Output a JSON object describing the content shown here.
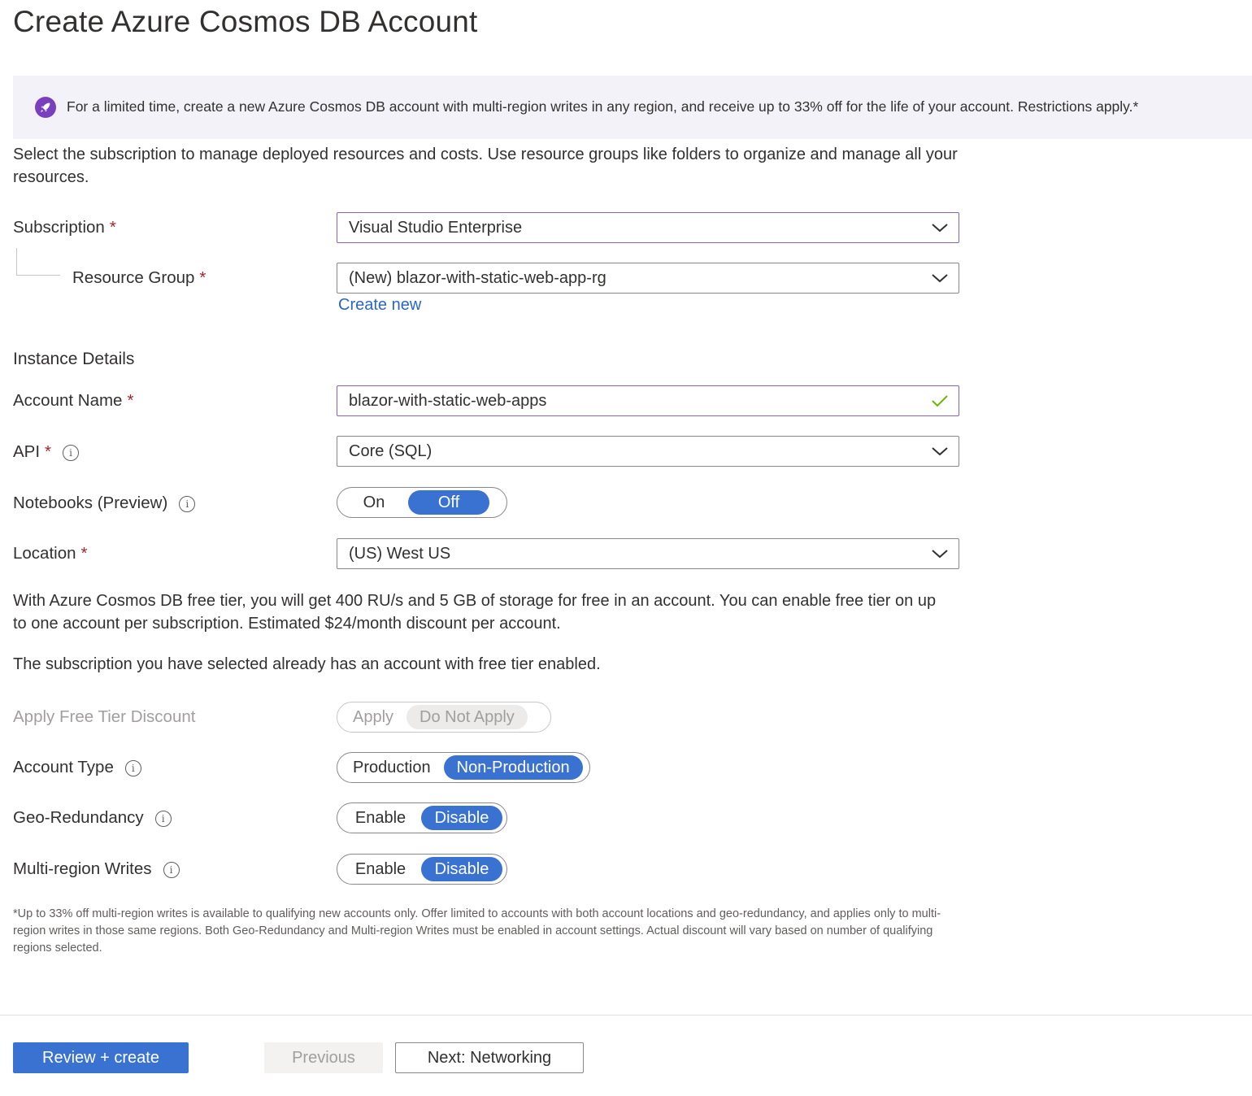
{
  "page": {
    "title": "Create Azure Cosmos DB Account"
  },
  "banner": {
    "icon": "rocket-icon",
    "text": "For a limited time, create a new Azure Cosmos DB account with multi-region writes in any region, and receive up to 33% off for the life of your account. Restrictions apply.*"
  },
  "intro": "Select the subscription to manage deployed resources and costs. Use resource groups like folders to organize and manage all your resources.",
  "required_marker": "*",
  "subscription": {
    "label": "Subscription",
    "value": "Visual Studio Enterprise"
  },
  "resource_group": {
    "label": "Resource Group",
    "value": "(New) blazor-with-static-web-app-rg",
    "create_new": "Create new"
  },
  "instance_details": {
    "heading": "Instance Details"
  },
  "account_name": {
    "label": "Account Name",
    "value": "blazor-with-static-web-apps"
  },
  "api": {
    "label": "API",
    "value": "Core (SQL)"
  },
  "notebooks": {
    "label": "Notebooks (Preview)",
    "options": [
      "On",
      "Off"
    ],
    "selected": "Off"
  },
  "location": {
    "label": "Location",
    "value": "(US) West US"
  },
  "free_tier_info": "With Azure Cosmos DB free tier, you will get 400 RU/s and 5 GB of storage for free in an account. You can enable free tier on up to one account per subscription. Estimated $24/month discount per account.",
  "free_tier_notice": "The subscription you have selected already has an account with free tier enabled.",
  "apply_free_tier": {
    "label": "Apply Free Tier Discount",
    "options": [
      "Apply",
      "Do Not Apply"
    ],
    "selected": "Do Not Apply"
  },
  "account_type": {
    "label": "Account Type",
    "options": [
      "Production",
      "Non-Production"
    ],
    "selected": "Non-Production"
  },
  "geo_redundancy": {
    "label": "Geo-Redundancy",
    "options": [
      "Enable",
      "Disable"
    ],
    "selected": "Disable"
  },
  "multi_region_writes": {
    "label": "Multi-region Writes",
    "options": [
      "Enable",
      "Disable"
    ],
    "selected": "Disable"
  },
  "footnote": "*Up to 33% off multi-region writes is available to qualifying new accounts only. Offer limited to accounts with both account locations and geo-redundancy, and applies only to multi-region writes in those same regions. Both Geo-Redundancy and Multi-region Writes must be enabled in account settings. Actual discount will vary based on number of qualifying regions selected.",
  "buttons": {
    "review_create": "Review + create",
    "previous": "Previous",
    "next": "Next: Networking"
  },
  "colors": {
    "accent": "#3a72d2",
    "focus_border": "#8661c5",
    "required": "#a4262c",
    "link": "#2b66c7",
    "banner_bg": "#f3f2f8",
    "banner_icon": "#7a3fbf",
    "valid_check": "#6bb700"
  }
}
